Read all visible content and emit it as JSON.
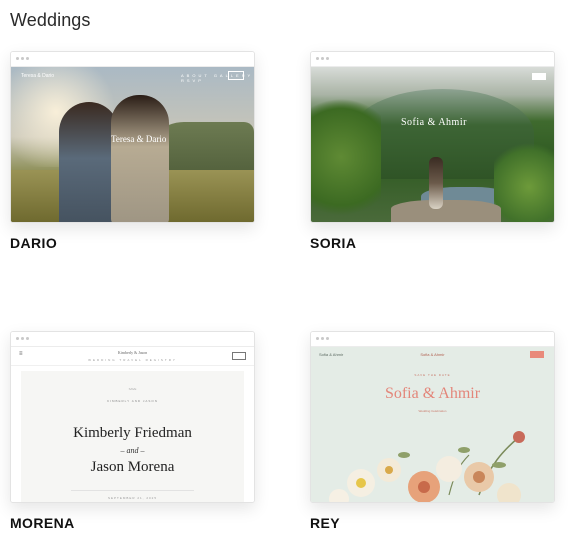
{
  "section": {
    "title": "Weddings"
  },
  "templates": [
    {
      "label": "DARIO",
      "preview": {
        "brand": "Teresa & Dario",
        "nav_links": "ABOUT GALLERY RSVP",
        "title": "Teresa & Dario"
      }
    },
    {
      "label": "SORIA",
      "preview": {
        "title": "Sofia & Ahmir"
      }
    },
    {
      "label": "MORENA",
      "preview": {
        "brand": "Kimberly & Jason",
        "nav_links": "WEDDING TRAVEL REGISTRY",
        "tiny1": "SAVE",
        "tiny2": "KIMBERLY AND JASON",
        "name1": "Kimberly Friedman",
        "and": "– and –",
        "name2": "Jason Morena",
        "tiny3": "SEPTEMBER 21, 2025"
      }
    },
    {
      "label": "REY",
      "preview": {
        "brand": "Sofia & Ahmir",
        "nav": "Sofia & Ahmir",
        "eyebrow": "SAVE THE DATE",
        "names": "Sofia & Ahmir",
        "sub": "Wedding Celebration"
      }
    }
  ],
  "icons": {
    "menu": "hamburger-icon",
    "browser_dots": "window-dots-icon"
  }
}
